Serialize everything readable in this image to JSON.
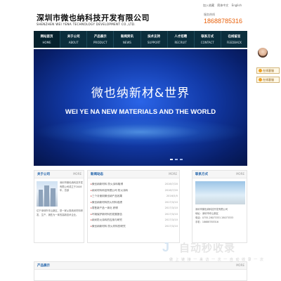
{
  "header": {
    "company_cn": "深圳市微也纳科技开发有限公司",
    "company_en": "SHENZHEN WEI YENA TECHNOLOGY DEVELOPMENT CO.,LTD.",
    "top_links": [
      "加入收藏",
      "简体中文",
      "English"
    ],
    "hotline_label": "服务热线",
    "hotline": "18688785316"
  },
  "nav": [
    {
      "cn": "网站首页",
      "en": "HOME"
    },
    {
      "cn": "关于公司",
      "en": "ABOUT"
    },
    {
      "cn": "产品展示",
      "en": "PRODUCT"
    },
    {
      "cn": "新闻资讯",
      "en": "NEWS"
    },
    {
      "cn": "技术支持",
      "en": "SUPPORT"
    },
    {
      "cn": "人才招聘",
      "en": "RECRUIT"
    },
    {
      "cn": "联系方式",
      "en": "CONTACT"
    },
    {
      "cn": "在线留言",
      "en": "FEEDBACK"
    }
  ],
  "banner": {
    "title_cn": "微也纳新材&世界",
    "title_en": "WEI YE NA NEW MATERIALS AND THE WORLD"
  },
  "kefu": {
    "buttons": [
      "在线客服",
      "在线客服"
    ]
  },
  "about": {
    "title": "关于公司",
    "more": "MORE",
    "text_side": "深圳市微也纳科技开发有限公司成立于2008年，总部",
    "text_body": "位于深圳市坪山新区，是一家从事纳米材料研发、生产、销售为一体的高新技术企业。"
  },
  "news": {
    "title": "新闻动态",
    "more": "MORE",
    "items": [
      {
        "title": "微也纳新材料 防火涂料取得",
        "date": "2016/7/20"
      },
      {
        "title": "纳米材料科技有限公司 防火涂料",
        "date": "2016/7/20"
      },
      {
        "title": "三个月使用微也纳产品效果",
        "date": "2016/5/5"
      },
      {
        "title": "微也纳新材料防火材料成绩",
        "date": "2017/3/10"
      },
      {
        "title": "零售新产品一体化 获得",
        "date": "2017/3/10"
      },
      {
        "title": "环境保护新材料的发展报告",
        "date": "2017/3/10"
      },
      {
        "title": "纳米防火涂料的应用与研究",
        "date": "2017/3/10"
      },
      {
        "title": "微也纳新材料 防火材料的研究",
        "date": "2017/3/10"
      }
    ]
  },
  "contact": {
    "title": "联系方式",
    "more": "MORE",
    "lines": [
      "深圳市微也纳科技开发有限公司",
      "地址：深圳市坪山新区",
      "电话：0755-28073331 28073333",
      "手机：18688785316"
    ]
  },
  "products": {
    "title": "产品展示",
    "more": "MORE"
  },
  "watermark": {
    "text": "自动秒收录",
    "sub": "做 上 链 接 一 来 访 一 次 一 自 动 收 录 一 次"
  }
}
